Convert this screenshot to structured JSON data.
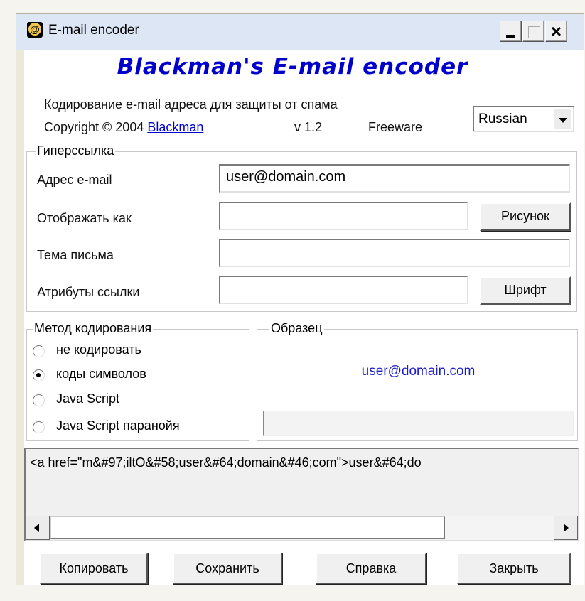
{
  "window": {
    "title": "E-mail encoder",
    "icon": "at-sign-icon"
  },
  "header": {
    "app_name": "Blackman's E-mail encoder",
    "description": "Кодирование e-mail адреса для защиты от спама",
    "copyright": "Copyright © 2004",
    "author": "Blackman",
    "version": "v 1.2",
    "license": "Freeware"
  },
  "language": {
    "selected": "Russian"
  },
  "hyperlink": {
    "legend": "Гиперссылка",
    "email_label": "Адрес e-mail",
    "email_value": "user@domain.com",
    "display_label": "Отображать как",
    "display_value": "",
    "image_button": "Рисунок",
    "subject_label": "Тема письма",
    "subject_value": "",
    "attributes_label": "Атрибуты ссылки",
    "attributes_value": "",
    "font_button": "Шрифт"
  },
  "encoding": {
    "legend": "Метод кодирования",
    "options": [
      "не кодировать",
      "коды символов",
      "Java Script",
      "Java Script паранойя"
    ],
    "selected": "коды символов"
  },
  "sample": {
    "legend": "Образец",
    "link_text": "user@domain.com"
  },
  "output": {
    "code": "<a href=\"m&#97;iltO&#58;user&#64;domain&#46;com\">user&#64;do"
  },
  "buttons": {
    "copy": "Копировать",
    "save": "Сохранить",
    "help": "Справка",
    "close": "Закрыть"
  }
}
